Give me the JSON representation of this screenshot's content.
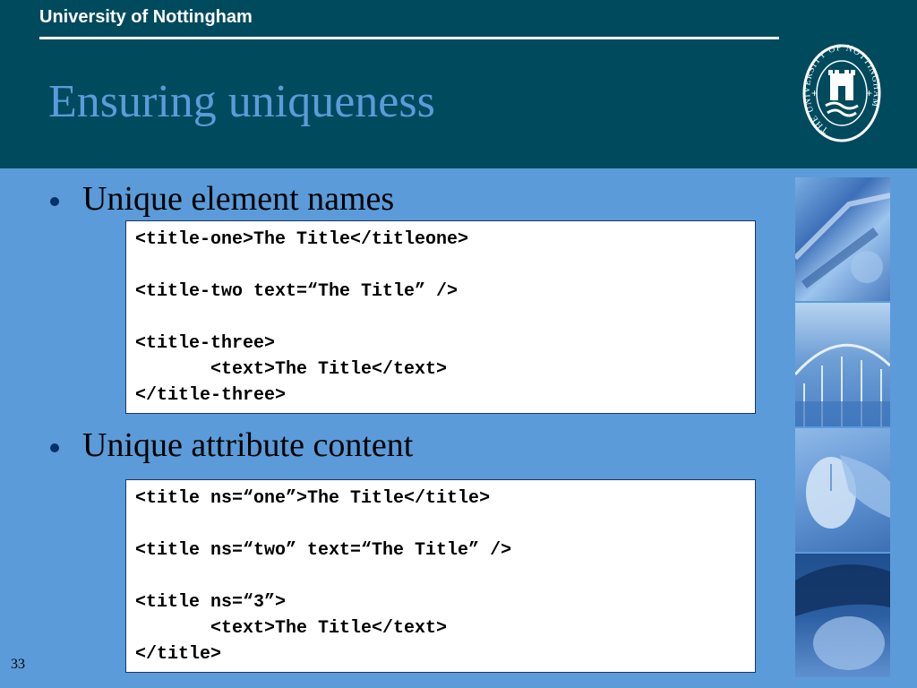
{
  "header": {
    "brand": "University of Nottingham",
    "title": "Ensuring uniqueness",
    "seal_text": "THE UNIVERSITY OF NOTTINGHAM"
  },
  "bullets": [
    {
      "label": "Unique element names",
      "code": [
        "<title-one>The Title</titleone>",
        "",
        "<title-two text=“The Title” />",
        "",
        "<title-three>",
        "       <text>The Title</text>",
        "</title-three>"
      ]
    },
    {
      "label": "Unique attribute content",
      "code": [
        "<title ns=“one”>The Title</title>",
        "",
        "<title ns=“two” text=“The Title” />",
        "",
        "<title ns=“3”>",
        "       <text>The Title</text>",
        "</title>"
      ]
    }
  ],
  "footer": {
    "page_number": "33"
  },
  "colors": {
    "header_bg": "#004a5e",
    "slide_bg": "#5b9bd9",
    "title": "#5b9bd9",
    "bullet_dot": "#00316b"
  }
}
